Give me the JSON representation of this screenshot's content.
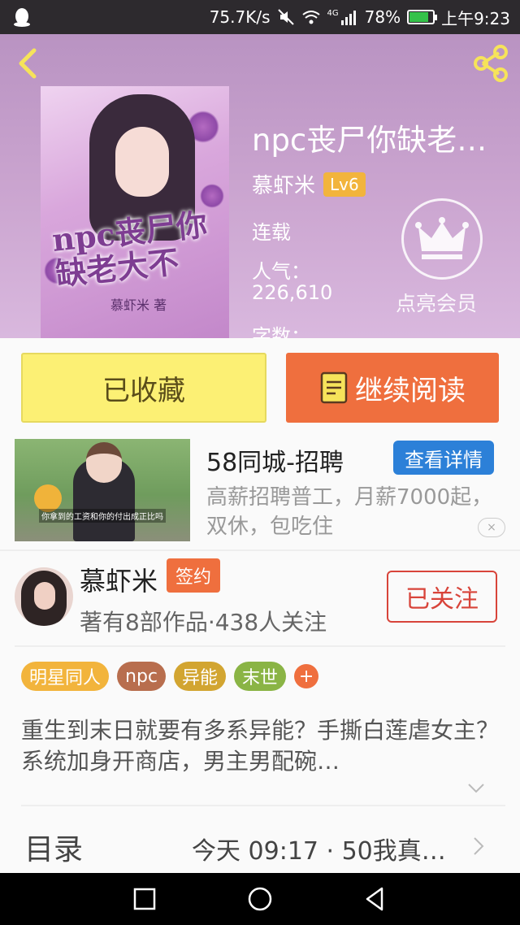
{
  "status_bar": {
    "network_speed": "75.7K/s",
    "signal_label": "4G",
    "battery": "78%",
    "battery_level": 0.78,
    "time": "上午9:23"
  },
  "book": {
    "title": "npc丧尸你缺老…",
    "cover_title_art": "npc丧尸你缺老大不",
    "cover_author_art": "慕虾米 著",
    "author": "慕虾米",
    "level": "Lv6",
    "status": "连载",
    "popularity_label": "人气：",
    "popularity_value": "226,610",
    "word_count_label": "字数：",
    "vip_label": "点亮会员"
  },
  "actions": {
    "collected_label": "已收藏",
    "continue_label": "继续阅读"
  },
  "ad": {
    "title": "58同城-招聘",
    "detail_label": "查看详情",
    "description": "高薪招聘普工，月薪7000起，双休，包吃住",
    "image_caption": "你拿到的工资和你的付出成正比吗",
    "close_label": "×"
  },
  "author_info": {
    "name": "慕虾米",
    "badge": "签约",
    "stats": "著有8部作品·438人关注",
    "follow_label": "已关注"
  },
  "tags": [
    {
      "label": "明星同人",
      "color": "#f2b43c"
    },
    {
      "label": "npc",
      "color": "#b86e4e"
    },
    {
      "label": "异能",
      "color": "#d2a531"
    },
    {
      "label": "末世",
      "color": "#8ab445"
    }
  ],
  "tag_more": "+",
  "synopsis": "重生到末日就要有多系异能？手撕白莲虐女主？系统加身开商店，男主男配碗…",
  "toc": {
    "label": "目录",
    "latest": "今天 09:17 · 50我真…"
  },
  "colors": {
    "accent_orange": "#ef6f3e",
    "collected_yellow": "#fcf074",
    "ad_blue": "#2c80d8",
    "follow_red": "#d8443a"
  }
}
